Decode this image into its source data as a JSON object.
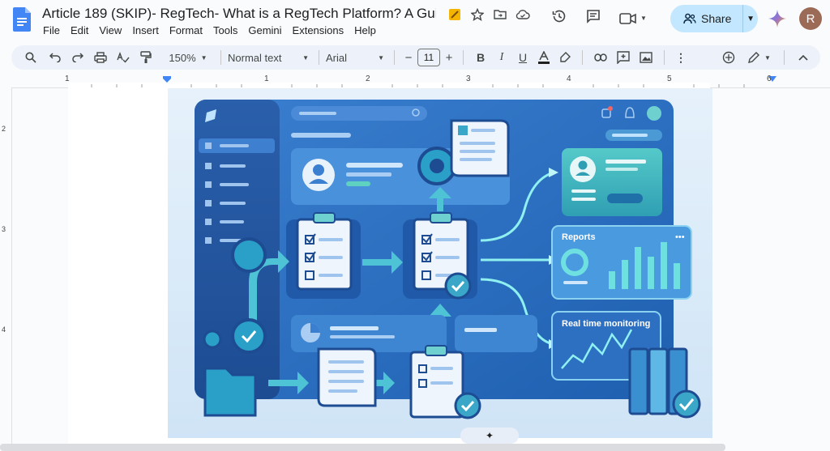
{
  "document": {
    "title": "Article 189 (SKIP)- RegTech- What is a RegTech Platform? A Guide fo..."
  },
  "menu": [
    "File",
    "Edit",
    "View",
    "Insert",
    "Format",
    "Tools",
    "Gemini",
    "Extensions",
    "Help"
  ],
  "share": {
    "label": "Share"
  },
  "user": {
    "initial": "R"
  },
  "toolbar": {
    "zoom": "150%",
    "style": "Normal text",
    "font": "Arial",
    "font_size": "11",
    "minus": "−",
    "plus": "+"
  },
  "ruler": {
    "h": [
      "1",
      "1",
      "2",
      "3",
      "4",
      "5",
      "6"
    ],
    "v": [
      "2",
      "3",
      "4"
    ]
  },
  "illustration": {
    "reports_label": "Reports",
    "monitoring_label": "Real time monitoring"
  },
  "colors": {
    "accent": "#c2e7ff",
    "doc_blue": "#4285f4",
    "panel": "#2d6fc4"
  }
}
